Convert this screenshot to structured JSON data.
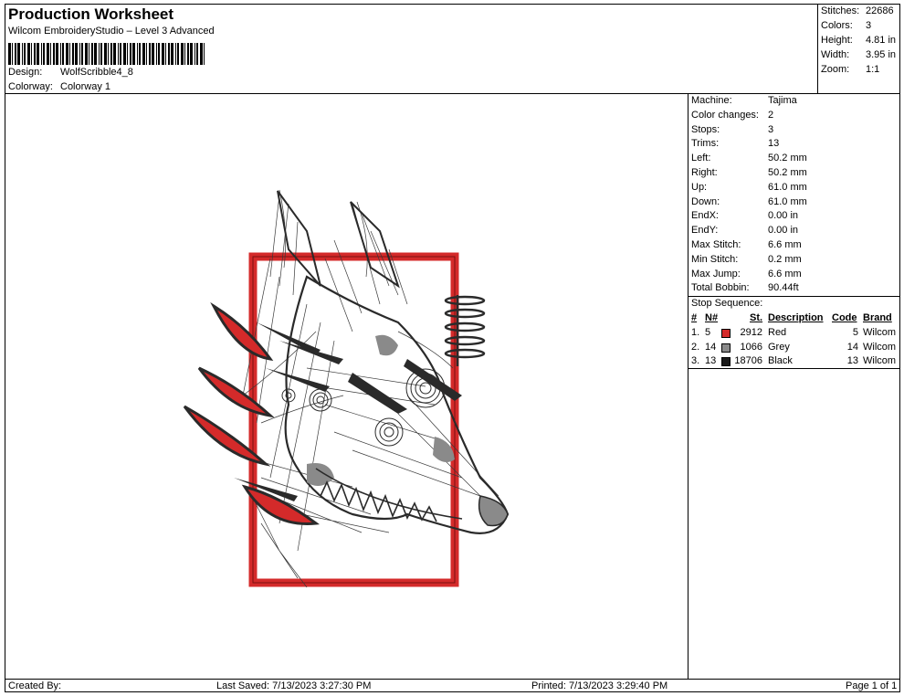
{
  "header": {
    "title": "Production Worksheet",
    "subtitle": "Wilcom EmbroideryStudio – Level 3 Advanced",
    "design_label": "Design:",
    "design_value": "WolfScribble4_8",
    "colorway_label": "Colorway:",
    "colorway_value": "Colorway 1"
  },
  "summary": [
    {
      "label": "Stitches:",
      "value": "22686"
    },
    {
      "label": "Colors:",
      "value": "3"
    },
    {
      "label": "Height:",
      "value": "4.81 in"
    },
    {
      "label": "Width:",
      "value": "3.95 in"
    },
    {
      "label": "Zoom:",
      "value": "1:1"
    }
  ],
  "machine_info": [
    {
      "label": "Machine:",
      "value": "Tajima"
    },
    {
      "label": "Color changes:",
      "value": "2"
    },
    {
      "label": "Stops:",
      "value": "3"
    },
    {
      "label": "Trims:",
      "value": "13"
    },
    {
      "label": "Left:",
      "value": "50.2 mm"
    },
    {
      "label": "Right:",
      "value": "50.2 mm"
    },
    {
      "label": "Up:",
      "value": "61.0 mm"
    },
    {
      "label": "Down:",
      "value": "61.0 mm"
    },
    {
      "label": "EndX:",
      "value": "0.00 in"
    },
    {
      "label": "EndY:",
      "value": "0.00 in"
    },
    {
      "label": "Max Stitch:",
      "value": "6.6 mm"
    },
    {
      "label": "Min Stitch:",
      "value": "0.2 mm"
    },
    {
      "label": "Max Jump:",
      "value": "6.6 mm"
    },
    {
      "label": "Total Bobbin:",
      "value": "90.44ft"
    }
  ],
  "stop_sequence": {
    "title": "Stop Sequence:",
    "columns": {
      "num": "#",
      "n": "N#",
      "st": "St.",
      "description": "Description",
      "code": "Code",
      "brand": "Brand"
    },
    "rows": [
      {
        "num": "1.",
        "n": "5",
        "color": "#d42a2a",
        "st": "2912",
        "description": "Red",
        "code": "5",
        "brand": "Wilcom"
      },
      {
        "num": "2.",
        "n": "14",
        "color": "#8a8a8a",
        "st": "1066",
        "description": "Grey",
        "code": "14",
        "brand": "Wilcom"
      },
      {
        "num": "3.",
        "n": "13",
        "color": "#1a1a1a",
        "st": "18706",
        "description": "Black",
        "code": "13",
        "brand": "Wilcom"
      }
    ]
  },
  "footer": {
    "created_by": "Created By:",
    "last_saved": "Last Saved: 7/13/2023 3:27:30 PM",
    "printed": "Printed: 7/13/2023 3:29:40 PM",
    "page": "Page 1 of 1"
  },
  "design_colors": {
    "red": "#d42a2a",
    "grey": "#8a8a8a",
    "black": "#2a2a2a"
  }
}
